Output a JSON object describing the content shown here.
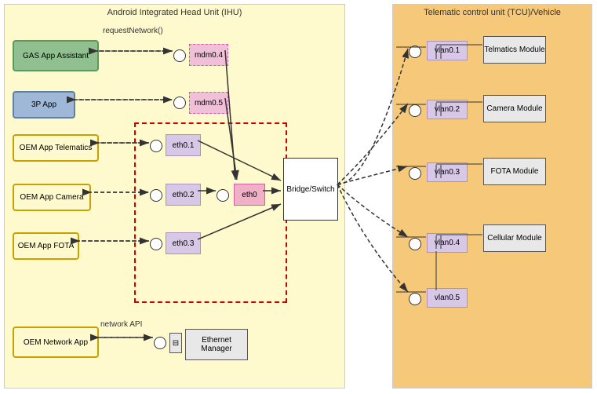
{
  "ihu": {
    "title": "Android Integrated Head Unit (IHU)",
    "apps": {
      "gas": "GAS App Assistant",
      "threep": "3P App",
      "oem_telematics": "OEM App Telematics",
      "oem_camera": "OEM App Camera",
      "oem_fota": "OEM App FOTA",
      "oem_network": "OEM Network App"
    },
    "labels": {
      "request_network": "requestNetwork()",
      "network_api": "network API"
    },
    "nodes": {
      "mdm04": "mdm0.4",
      "mdm05": "mdm0.5",
      "eth01": "eth0.1",
      "eth02": "eth0.2",
      "eth03": "eth0.3",
      "eth0": "eth0"
    },
    "bridge": "Bridge/Switch",
    "eth_manager": "Ethernet Manager"
  },
  "tcu": {
    "title": "Telematic control unit (TCU)/Vehicle",
    "modules": {
      "telmatics": "Telmatics Module",
      "camera": "Camera Module",
      "fota": "FOTA Module",
      "cellular": "Cellular Module"
    },
    "vlans": {
      "vlan01": "vlan0.1",
      "vlan02": "vlan0.2",
      "vlan03": "vlan0.3",
      "vlan04": "vlan0.4",
      "vlan05": "vlan0.5"
    }
  }
}
